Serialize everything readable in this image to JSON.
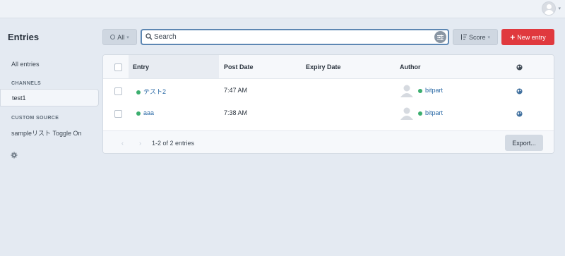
{
  "header": {
    "user_avatar_icon": "user-avatar-icon",
    "user_menu_caret": "▾"
  },
  "sidebar": {
    "title": "Entries",
    "all_entries": "All entries",
    "channels_heading": "CHANNELS",
    "channels": [
      {
        "label": "test1",
        "active": true
      }
    ],
    "custom_source_heading": "CUSTOM SOURCE",
    "custom_sources": [
      {
        "label": "sampleリスト Toggle On"
      }
    ],
    "settings_icon": "gear-icon"
  },
  "toolbar": {
    "status_filter_label": "All",
    "search_placeholder": "Search",
    "search_value": "",
    "sort_label": "Score",
    "new_entry_label": "New entry",
    "new_entry_plus": "+"
  },
  "table": {
    "columns": {
      "entry": "Entry",
      "post_date": "Post Date",
      "expiry_date": "Expiry Date",
      "author": "Author"
    },
    "rows": [
      {
        "title": "テスト2",
        "post_date": "7:47 AM",
        "expiry_date": "",
        "author": "bitpart",
        "status_color": "#3bae6e"
      },
      {
        "title": "aaa",
        "post_date": "7:38 AM",
        "expiry_date": "",
        "author": "bitpart",
        "status_color": "#3bae6e"
      }
    ]
  },
  "footer": {
    "prev_arrow": "‹",
    "next_arrow": "›",
    "pagination_text": "1-2 of 2 entries",
    "export_label": "Export..."
  },
  "colors": {
    "accent": "#e0393e",
    "link": "#2b6aa6",
    "status_live": "#3bae6e",
    "search_border": "#5d87b3"
  }
}
